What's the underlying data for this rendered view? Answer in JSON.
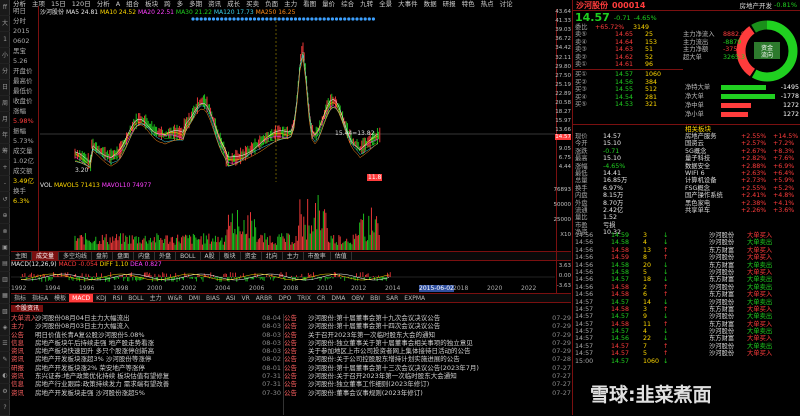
{
  "top_tabs": [
    "分析",
    "主项",
    "15日",
    "120日",
    "分析",
    "A",
    "组合",
    "板块",
    "跨",
    "多",
    "多期",
    "资讯",
    "成长",
    "买卖",
    "负面",
    "主力",
    "看图",
    "量价",
    "综合",
    "九转",
    "全景",
    "大事件",
    "数据",
    "研报",
    "特色",
    "热点",
    "讨论"
  ],
  "side_menu": [
    "明日",
    "分时",
    "2015",
    "0602",
    "黑宝",
    "5.26",
    "开盘价",
    "最高价",
    "最低价",
    "收盘价",
    "涨幅",
    "5.98%",
    "振幅",
    "5.73%",
    "成交量",
    "1.02亿",
    "成交额",
    "3.49亿",
    "换手",
    "6.3%"
  ],
  "left_toolbar": [
    "ff",
    "大",
    "1",
    "小",
    "分",
    "日",
    "周",
    "月",
    "年",
    "筹",
    "+",
    "-",
    "↺",
    "⊕",
    "⊗",
    "▣",
    "▤",
    "▥",
    "▦",
    "▧",
    "◈",
    "☰",
    "✎",
    "◐",
    "⚙",
    "?"
  ],
  "ma_legend": {
    "name": "沙河股份",
    "ma5": "MA5 24.81",
    "ma10": "MA10 24.52",
    "ma20": "MA20 22.51",
    "ma30": "MA30 21.22",
    "ma120": "MA120 17.73",
    "ma250": "MA250 16.25"
  },
  "main_chart": {
    "last_label": "15.44=13.82",
    "low_label": "3.20",
    "bubble": "11.8"
  },
  "vol_legend": {
    "title": "VOL",
    "mavol5": "MAVOL5 71413",
    "mavol10": "MAVOL10 74977"
  },
  "indicator_tabs": [
    "主图",
    "成交量",
    "多空均线",
    "盘前",
    "盘面",
    "内盘",
    "外盘",
    "BOLL",
    "A股",
    "板块",
    "资金",
    "北向",
    "主力",
    "市盈率",
    "估值"
  ],
  "macd_legend": {
    "name": "MACD(12,26,9)",
    "macd": "MACD -0.054",
    "diff": "DIFF 1.10",
    "dea": "DEA 0.827"
  },
  "right_axis": {
    "price_ticks": [
      "43.64",
      "41.33",
      "39.03",
      "36.72",
      "34.42",
      "32.11",
      "29.80",
      "27.50",
      "25.19",
      "22.89",
      "20.58",
      "18.27",
      "15.97",
      "13.66",
      "11.36",
      "9.05",
      "6.75",
      "4.44"
    ],
    "last_price": "14.57",
    "vol_ticks": [
      "76893",
      "50000",
      "25000",
      "X10"
    ],
    "macd_ticks": [
      "3.63",
      "0.00",
      "-3.63"
    ]
  },
  "year_axis": [
    "1992",
    "1994",
    "1996",
    "1998",
    "2000",
    "2002",
    "2004",
    "2006",
    "2008",
    "2010",
    "2012",
    "2014",
    "2015-06-02",
    "2018",
    "2020",
    "2022"
  ],
  "func_tabs": [
    {
      "label": "指标",
      "active": false
    },
    {
      "label": "指标A",
      "active": false
    },
    {
      "label": "模板",
      "active": false
    },
    {
      "label": "MACD",
      "active": true
    },
    {
      "label": "KDJ",
      "active": false
    },
    {
      "label": "RSI",
      "active": false
    },
    {
      "label": "BOLL",
      "active": false
    },
    {
      "label": "主力",
      "active": false
    },
    {
      "label": "W&R",
      "active": false
    },
    {
      "label": "DMI",
      "active": false
    },
    {
      "label": "BIAS",
      "active": false
    },
    {
      "label": "ASI",
      "active": false
    },
    {
      "label": "VR",
      "active": false
    },
    {
      "label": "ARBR",
      "active": false
    },
    {
      "label": "DPO",
      "active": false
    },
    {
      "label": "TRIX",
      "active": false
    },
    {
      "label": "CR",
      "active": false
    },
    {
      "label": "DMA",
      "active": false
    },
    {
      "label": "OBV",
      "active": false
    },
    {
      "label": "BBI",
      "active": false
    },
    {
      "label": "SAR",
      "active": false
    },
    {
      "label": "EXPMA",
      "active": false
    }
  ],
  "news_tab": "个股资讯",
  "news_left": [
    {
      "tag": "大单流入",
      "title": "沙河股份08月04日主力大幅流出",
      "date": "08-04"
    },
    {
      "tag": "主力",
      "title": "沙河股份08月03日主力大幅流入",
      "date": "08-03"
    },
    {
      "tag": "公告",
      "title": "明日价值长青A复公股沙河股份5.08%",
      "date": "08-03"
    },
    {
      "tag": "信息",
      "title": "房地产板块午后持续走强 地产股走势看涨",
      "date": "08-03"
    },
    {
      "tag": "资讯",
      "title": "房地产板块快速回升 多只个股涨停创新高",
      "date": "08-03"
    },
    {
      "tag": "资讯",
      "title": "房地产开发板块涨超3% 沙河股份等涨停",
      "date": "08-02"
    },
    {
      "tag": "研报",
      "title": "房地产开发板块涨2% 荣安地产等涨停",
      "date": "08-01"
    },
    {
      "tag": "资讯",
      "title": "东兴证券:地产政策优化持续 板块估值有望修复",
      "date": "07-31"
    },
    {
      "tag": "信息",
      "title": "房地产行业跟踪:政策持续发力 需求端有望改善",
      "date": "07-31"
    },
    {
      "tag": "资讯",
      "title": "房地产开发板块走强 沙河股份涨超5%",
      "date": "07-30"
    }
  ],
  "news_right": [
    {
      "tag": "公告",
      "title": "沙河股份:第十届董事会第十九次会议决议公告",
      "date": "07-29"
    },
    {
      "tag": "公告",
      "title": "沙河股份:第十届董事会第十四次会议决议公告",
      "date": "07-29"
    },
    {
      "tag": "公告",
      "title": "关于召开2023年第一次临时股东大会的通知",
      "date": "07-29"
    },
    {
      "tag": "公告",
      "title": "沙河股份:独立董事关于第十届董事会相关事项的独立意见",
      "date": "07-29"
    },
    {
      "tag": "公告",
      "title": "关于参加地区上市公司投资者网上集体接待日活动的公告",
      "date": "07-29"
    },
    {
      "tag": "公告",
      "title": "沙河股份:关于公司控股股东增持计划实施进展的公告",
      "date": "07-28"
    },
    {
      "tag": "公告",
      "title": "沙河股份:第十届董事会第十三次会议决议公告(2023年7月)",
      "date": "07-27"
    },
    {
      "tag": "公告",
      "title": "沙河股份:关于召开2023年第一次临时股东大会通知",
      "date": "07-27"
    },
    {
      "tag": "公告",
      "title": "沙河股份:独立董事工作细则(2023年修订)",
      "date": "07-27"
    },
    {
      "tag": "公告",
      "title": "沙河股份:董事会议事规则(2023年修订)",
      "date": "07-27"
    }
  ],
  "quote": {
    "stock_name": "沙河股份",
    "code": "000014",
    "price": "14.57",
    "change": "-0.71",
    "pct": "-4.65%",
    "industry": "房地产开发",
    "industry_pct": "-0.81%",
    "rank_text": "委比",
    "rank_val": "+65.72%",
    "wei_cha": "3149",
    "sell": [
      {
        "l": "卖⑤",
        "p": "14.65",
        "v": "25"
      },
      {
        "l": "卖④",
        "p": "14.64",
        "v": "153"
      },
      {
        "l": "卖③",
        "p": "14.63",
        "v": "51"
      },
      {
        "l": "卖②",
        "p": "14.62",
        "v": "52"
      },
      {
        "l": "卖①",
        "p": "14.61",
        "v": "96"
      }
    ],
    "buy": [
      {
        "l": "买①",
        "p": "14.57",
        "v": "1060"
      },
      {
        "l": "买②",
        "p": "14.56",
        "v": "384"
      },
      {
        "l": "买③",
        "p": "14.55",
        "v": "512"
      },
      {
        "l": "买④",
        "p": "14.54",
        "v": "281"
      },
      {
        "l": "买⑤",
        "p": "14.53",
        "v": "321"
      }
    ],
    "fund_flow_title": "主力资金",
    "flow": [
      {
        "label": "主力净流入",
        "val": "8882.9"
      },
      {
        "label": "主力流出",
        "val": "-8879"
      },
      {
        "label": "主力净额",
        "val": "-375.3"
      },
      {
        "label": "超大单",
        "val": "3265.3"
      }
    ],
    "net_buy": [
      {
        "label": "净特大单",
        "val": "-1495"
      },
      {
        "label": "净大单",
        "val": "-1778"
      },
      {
        "label": "净中单",
        "val": "1272"
      },
      {
        "label": "净小单",
        "val": "1272"
      }
    ],
    "stats": [
      {
        "l": "现价",
        "v": "14.57"
      },
      {
        "l": "今开",
        "v": "15.10"
      },
      {
        "l": "涨跌",
        "v": "-0.71"
      },
      {
        "l": "最高",
        "v": "15.10"
      },
      {
        "l": "涨幅",
        "v": "-4.65%"
      },
      {
        "l": "最低",
        "v": "14.41"
      },
      {
        "l": "总量",
        "v": "16.85万"
      },
      {
        "l": "换手",
        "v": "6.97%"
      },
      {
        "l": "内盘",
        "v": "8.15万"
      },
      {
        "l": "外盘",
        "v": "8.70万"
      },
      {
        "l": "流通",
        "v": "2.42亿"
      },
      {
        "l": "量比",
        "v": "1.52"
      },
      {
        "l": "市盈",
        "v": "亏损"
      },
      {
        "l": "净资",
        "v": "10.32"
      }
    ],
    "related_title": "相关板块",
    "related": [
      {
        "n": "房地产服务",
        "p": "+2.55%",
        "c": "+14.5%"
      },
      {
        "n": "国资云",
        "p": "+2.57%",
        "c": "+7.2%"
      },
      {
        "n": "5G概念",
        "p": "+2.67%",
        "c": "+8.3%"
      },
      {
        "n": "量子科技",
        "p": "+2.82%",
        "c": "+7.6%"
      },
      {
        "n": "数据安全",
        "p": "+2.88%",
        "c": "+6.9%"
      },
      {
        "n": "WIFI 6",
        "p": "+2.63%",
        "c": "+6.4%"
      },
      {
        "n": "计算机设备",
        "p": "+2.73%",
        "c": "+5.9%"
      },
      {
        "n": "FSG概念",
        "p": "+2.55%",
        "c": "+5.2%"
      },
      {
        "n": "国产操作系统",
        "p": "+2.41%",
        "c": "+4.8%"
      },
      {
        "n": "黑色家电",
        "p": "+2.38%",
        "c": "+4.1%"
      },
      {
        "n": "共享单车",
        "p": "+2.26%",
        "c": "+3.6%"
      }
    ],
    "ticks": [
      {
        "t": "14:56",
        "p": "14.59",
        "v": "3",
        "d": "down"
      },
      {
        "t": "14:56",
        "p": "14.58",
        "v": "4",
        "d": "down"
      },
      {
        "t": "14:56",
        "p": "14.58",
        "v": "13",
        "d": "up"
      },
      {
        "t": "14:56",
        "p": "14.59",
        "v": "8",
        "d": "up"
      },
      {
        "t": "14:56",
        "p": "14.58",
        "v": "20",
        "d": "down"
      },
      {
        "t": "14:56",
        "p": "14.58",
        "v": "5",
        "d": "down"
      },
      {
        "t": "14:56",
        "p": "14.57",
        "v": "18",
        "d": "down"
      },
      {
        "t": "14:56",
        "p": "14.58",
        "v": "2",
        "d": "up"
      },
      {
        "t": "14:56",
        "p": "14.58",
        "v": "6",
        "d": "up"
      },
      {
        "t": "14:57",
        "p": "14.57",
        "v": "14",
        "d": "down"
      },
      {
        "t": "14:57",
        "p": "14.58",
        "v": "3",
        "d": "up"
      },
      {
        "t": "14:57",
        "p": "14.57",
        "v": "9",
        "d": "down"
      },
      {
        "t": "14:57",
        "p": "14.58",
        "v": "11",
        "d": "up"
      },
      {
        "t": "14:57",
        "p": "14.57",
        "v": "4",
        "d": "down"
      },
      {
        "t": "14:57",
        "p": "14.56",
        "v": "22",
        "d": "down"
      },
      {
        "t": "14:57",
        "p": "14.57",
        "v": "7",
        "d": "up"
      },
      {
        "t": "14:57",
        "p": "14.57",
        "v": "5",
        "d": "up"
      },
      {
        "t": "15:00",
        "p": "14.57",
        "v": "1060",
        "d": "down"
      }
    ],
    "bigorder_title": "大单净比",
    "bigorders": [
      {
        "n": "沙河股份",
        "a": "大单买入"
      },
      {
        "n": "沙河股份",
        "a": "大单卖出"
      },
      {
        "n": "东方财富",
        "a": "大单买入"
      },
      {
        "n": "沙河股份",
        "a": "大单买入"
      },
      {
        "n": "东方财富",
        "a": "大单卖出"
      },
      {
        "n": "沙河股份",
        "a": "大单买入"
      },
      {
        "n": "东方财富",
        "a": "大单卖出"
      },
      {
        "n": "沙河股份",
        "a": "大单卖出"
      },
      {
        "n": "东方财富",
        "a": "大单买入"
      },
      {
        "n": "沙河股份",
        "a": "大单卖出"
      },
      {
        "n": "东方财富",
        "a": "大单买入"
      },
      {
        "n": "沙河股份",
        "a": "大单卖出"
      },
      {
        "n": "东方财富",
        "a": "大单买入"
      },
      {
        "n": "沙河股份",
        "a": "大单卖出"
      },
      {
        "n": "东方财富",
        "a": "大单买入"
      },
      {
        "n": "沙河股份",
        "a": "大单卖出"
      },
      {
        "n": "沙河股份",
        "a": "大单买入"
      }
    ],
    "donut_label": "资金",
    "donut_sub": "流向"
  },
  "watermark": "雪球:韭菜煮面",
  "colors": {
    "up": "#ff3c3c",
    "down": "#20d020",
    "ma5": "#ffffff",
    "ma10": "#ffd800",
    "ma20": "#ff40ff",
    "ma30": "#20d020",
    "ma120": "#3ccfe8",
    "ma250": "#ff8c1a",
    "frame": "#7a1010"
  }
}
